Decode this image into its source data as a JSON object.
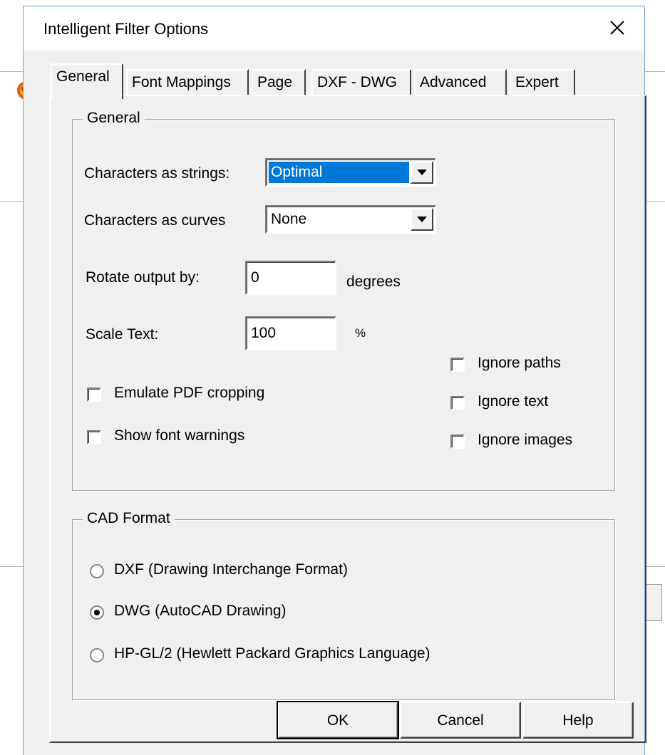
{
  "dialog": {
    "title": "Intelligent Filter Options",
    "close_icon": "close-icon"
  },
  "tabs": [
    {
      "label": "General",
      "active": true
    },
    {
      "label": "Font Mappings",
      "active": false
    },
    {
      "label": "Page",
      "active": false
    },
    {
      "label": "DXF - DWG",
      "active": false
    },
    {
      "label": "Advanced",
      "active": false
    },
    {
      "label": "Expert",
      "active": false
    }
  ],
  "general": {
    "group_label": "General",
    "chars_as_strings_label": "Characters as strings:",
    "chars_as_strings_value": "Optimal",
    "chars_as_curves_label": "Characters as curves",
    "chars_as_curves_value": "None",
    "rotate_label": "Rotate output by:",
    "rotate_value": "0",
    "rotate_unit": "degrees",
    "scale_label": "Scale Text:",
    "scale_value": "100",
    "scale_unit": "%",
    "emulate_pdf_cropping": {
      "label": "Emulate PDF cropping",
      "checked": false
    },
    "show_font_warnings": {
      "label": "Show font warnings",
      "checked": false
    },
    "ignore_paths": {
      "label": "Ignore paths",
      "checked": false
    },
    "ignore_text": {
      "label": "Ignore text",
      "checked": false
    },
    "ignore_images": {
      "label": "Ignore images",
      "checked": false
    }
  },
  "cad": {
    "group_label": "CAD Format",
    "options": [
      {
        "label": "DXF (Drawing Interchange Format)",
        "checked": false
      },
      {
        "label": "DWG (AutoCAD Drawing)",
        "checked": true
      },
      {
        "label": "HP-GL/2 (Hewlett Packard Graphics Language)",
        "checked": false
      }
    ]
  },
  "buttons": {
    "ok": "OK",
    "cancel": "Cancel",
    "help": "Help"
  },
  "colors": {
    "selection": "#0078d7",
    "dialog_face": "#f0f0f0",
    "border_accent": "#6fa3d8"
  }
}
